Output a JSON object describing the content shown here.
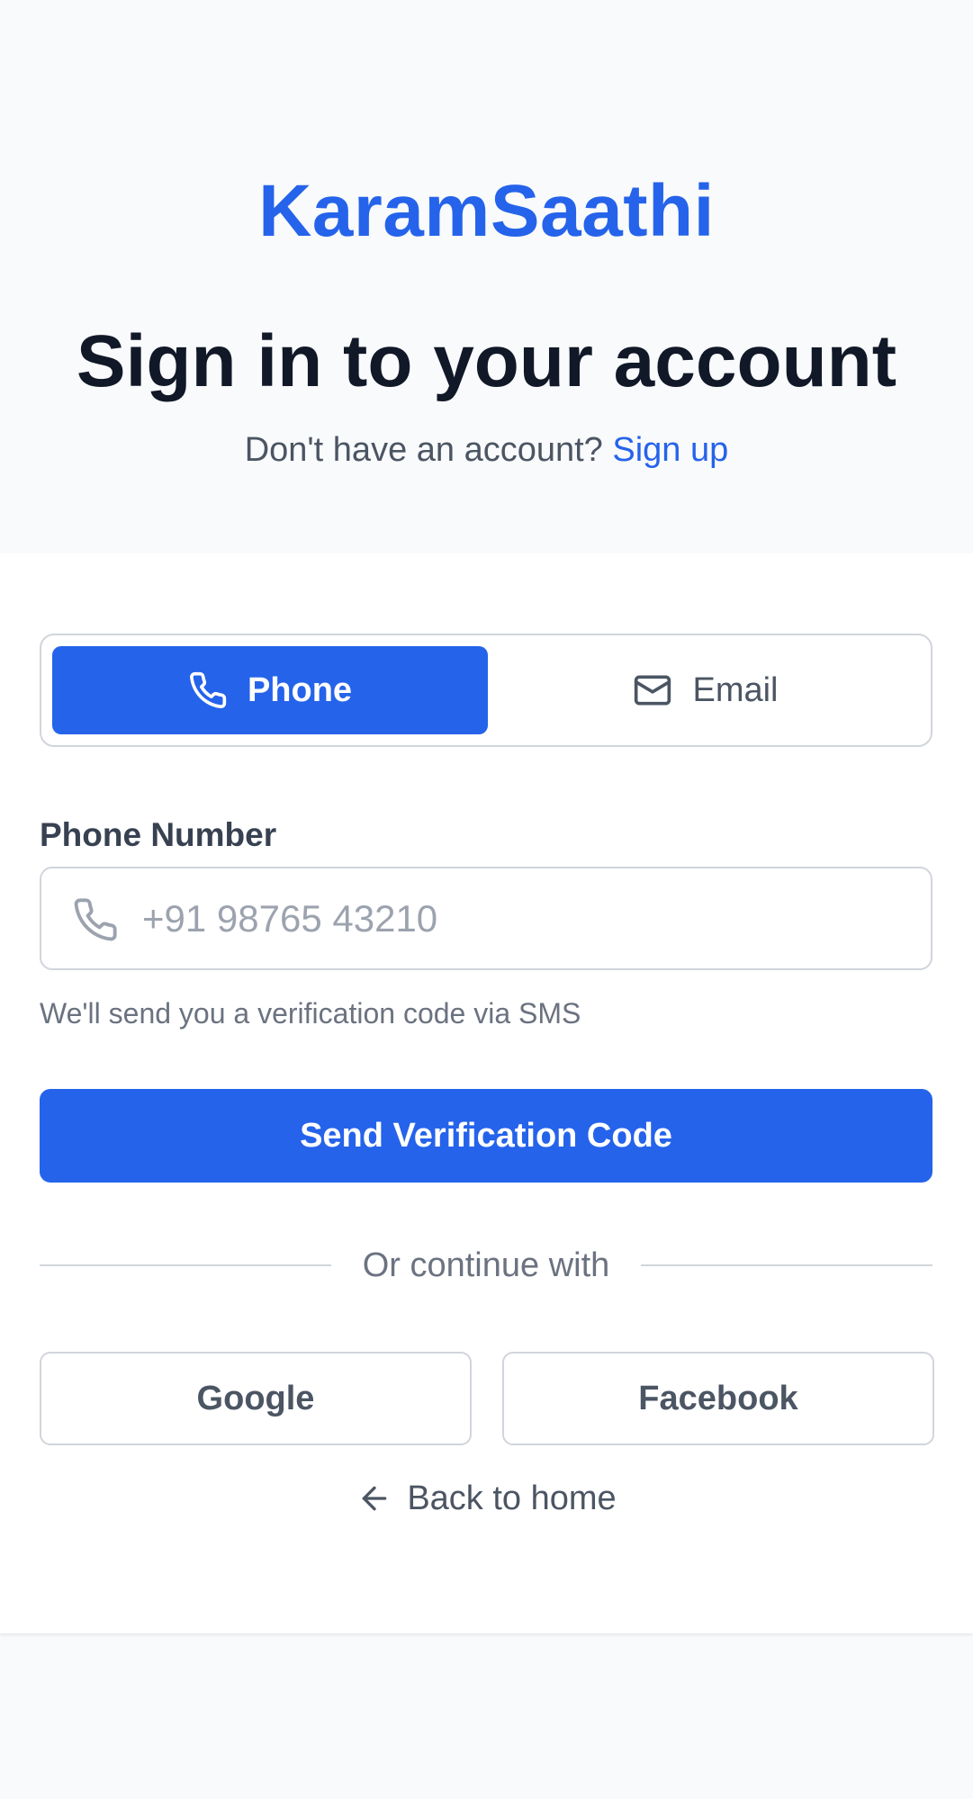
{
  "brand": {
    "name": "KaramSaathi",
    "color": "#2563eb"
  },
  "header": {
    "title": "Sign in to your account",
    "signup_prompt": "Don't have an account?",
    "signup_link": "Sign up"
  },
  "method_toggle": {
    "options": [
      {
        "label": "Phone",
        "icon": "phone-icon",
        "active": true
      },
      {
        "label": "Email",
        "icon": "mail-icon",
        "active": false
      }
    ]
  },
  "phone_field": {
    "label": "Phone Number",
    "icon": "phone-icon",
    "placeholder": "+91 98765 43210",
    "value": "",
    "helper": "We'll send you a verification code via SMS"
  },
  "primary_action": {
    "label": "Send Verification Code"
  },
  "divider": {
    "text": "Or continue with"
  },
  "social": {
    "google": "Google",
    "facebook": "Facebook"
  },
  "back": {
    "label": "Back to home",
    "icon": "arrow-left-icon"
  },
  "colors": {
    "accent": "#2563eb",
    "heading": "#111827",
    "muted": "#6b7280",
    "border": "#d1d5db",
    "background": "#f9fafb"
  }
}
